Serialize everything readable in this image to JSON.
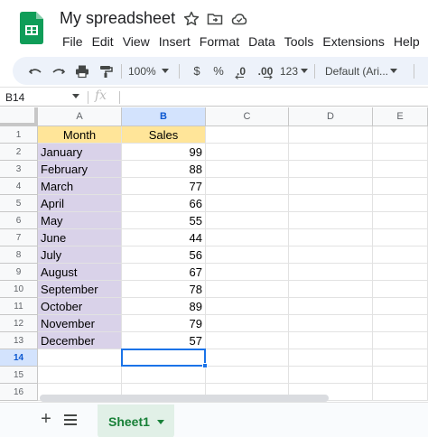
{
  "app": {
    "title": "My spreadsheet",
    "menus": [
      "File",
      "Edit",
      "View",
      "Insert",
      "Format",
      "Data",
      "Tools",
      "Extensions",
      "Help"
    ]
  },
  "toolbar": {
    "zoom": "100%",
    "currency": "$",
    "percent": "%",
    "decrease_decimals": ".0",
    "increase_decimals": ".00",
    "more_formats": "123",
    "font": "Default (Ari..."
  },
  "formula_bar": {
    "name_box": "B14",
    "fx": "fx",
    "value": ""
  },
  "grid": {
    "columns": [
      "A",
      "B",
      "C",
      "D",
      "E"
    ],
    "selected_column": "B",
    "selected_row": "14",
    "rows": [
      {
        "n": "1",
        "a": "Month",
        "b": "Sales"
      },
      {
        "n": "2",
        "a": "January",
        "b": "99"
      },
      {
        "n": "3",
        "a": "February",
        "b": "88"
      },
      {
        "n": "4",
        "a": "March",
        "b": "77"
      },
      {
        "n": "5",
        "a": "April",
        "b": "66"
      },
      {
        "n": "6",
        "a": "May",
        "b": "55"
      },
      {
        "n": "7",
        "a": "June",
        "b": "44"
      },
      {
        "n": "8",
        "a": "July",
        "b": "56"
      },
      {
        "n": "9",
        "a": "August",
        "b": "67"
      },
      {
        "n": "10",
        "a": "September",
        "b": "78"
      },
      {
        "n": "11",
        "a": "October",
        "b": "89"
      },
      {
        "n": "12",
        "a": "November",
        "b": "79"
      },
      {
        "n": "13",
        "a": "December",
        "b": "57"
      },
      {
        "n": "14",
        "a": "",
        "b": ""
      },
      {
        "n": "15",
        "a": "",
        "b": ""
      },
      {
        "n": "16",
        "a": "",
        "b": ""
      }
    ],
    "colors": {
      "header_fill": "#ffe599",
      "month_fill": "#d9d2e9",
      "selection": "#1a73e8"
    }
  },
  "sheets": {
    "active": "Sheet1",
    "add_icon": "+",
    "list_icon": "all-sheets-icon"
  }
}
